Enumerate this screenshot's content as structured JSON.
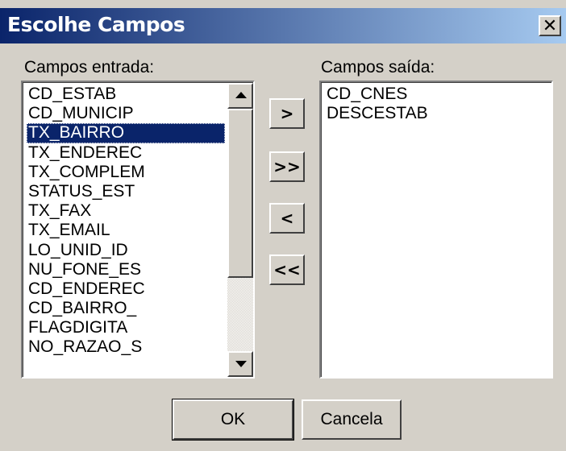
{
  "window": {
    "title": "Escolhe Campos",
    "close_label": "✕"
  },
  "input_list": {
    "label": "Campos entrada:",
    "items": [
      "CD_ESTAB",
      "CD_MUNICIP",
      "TX_BAIRRO",
      "TX_ENDEREC",
      "TX_COMPLEM",
      "STATUS_EST",
      "TX_FAX",
      "TX_EMAIL",
      "LO_UNID_ID",
      "NU_FONE_ES",
      "CD_ENDEREC",
      "CD_BAIRRO_",
      "FLAGDIGITA",
      "NO_RAZAO_S"
    ],
    "selected_index": 2
  },
  "output_list": {
    "label": "Campos saída:",
    "items": [
      "CD_CNES",
      "DESCESTAB"
    ]
  },
  "move_buttons": {
    "add_one": ">",
    "add_all": ">>",
    "remove_one": "<",
    "remove_all": "<<"
  },
  "buttons": {
    "ok": "OK",
    "cancel": "Cancela"
  },
  "colors": {
    "title_bar": "#0a246a",
    "selection": "#0a246a",
    "dialog_face": "#d4d0c8"
  }
}
